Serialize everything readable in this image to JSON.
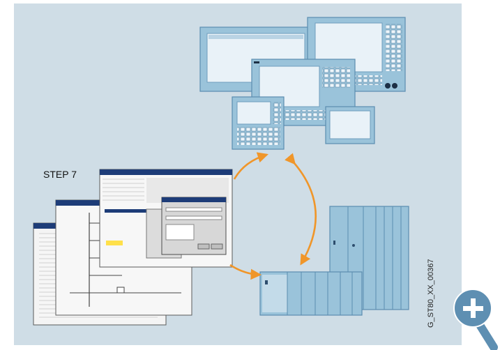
{
  "labels": {
    "step7": "STEP 7",
    "figure_id": "G_ST80_XX_00367"
  },
  "colors": {
    "panel_background": "#cfdde6",
    "arrow": "#f0962a",
    "device_blue": "#9ac3da",
    "screen": "#e9f2f8",
    "zoom_button": "#5e8fb2"
  },
  "icons": {
    "zoom": "magnifier-plus-icon"
  }
}
